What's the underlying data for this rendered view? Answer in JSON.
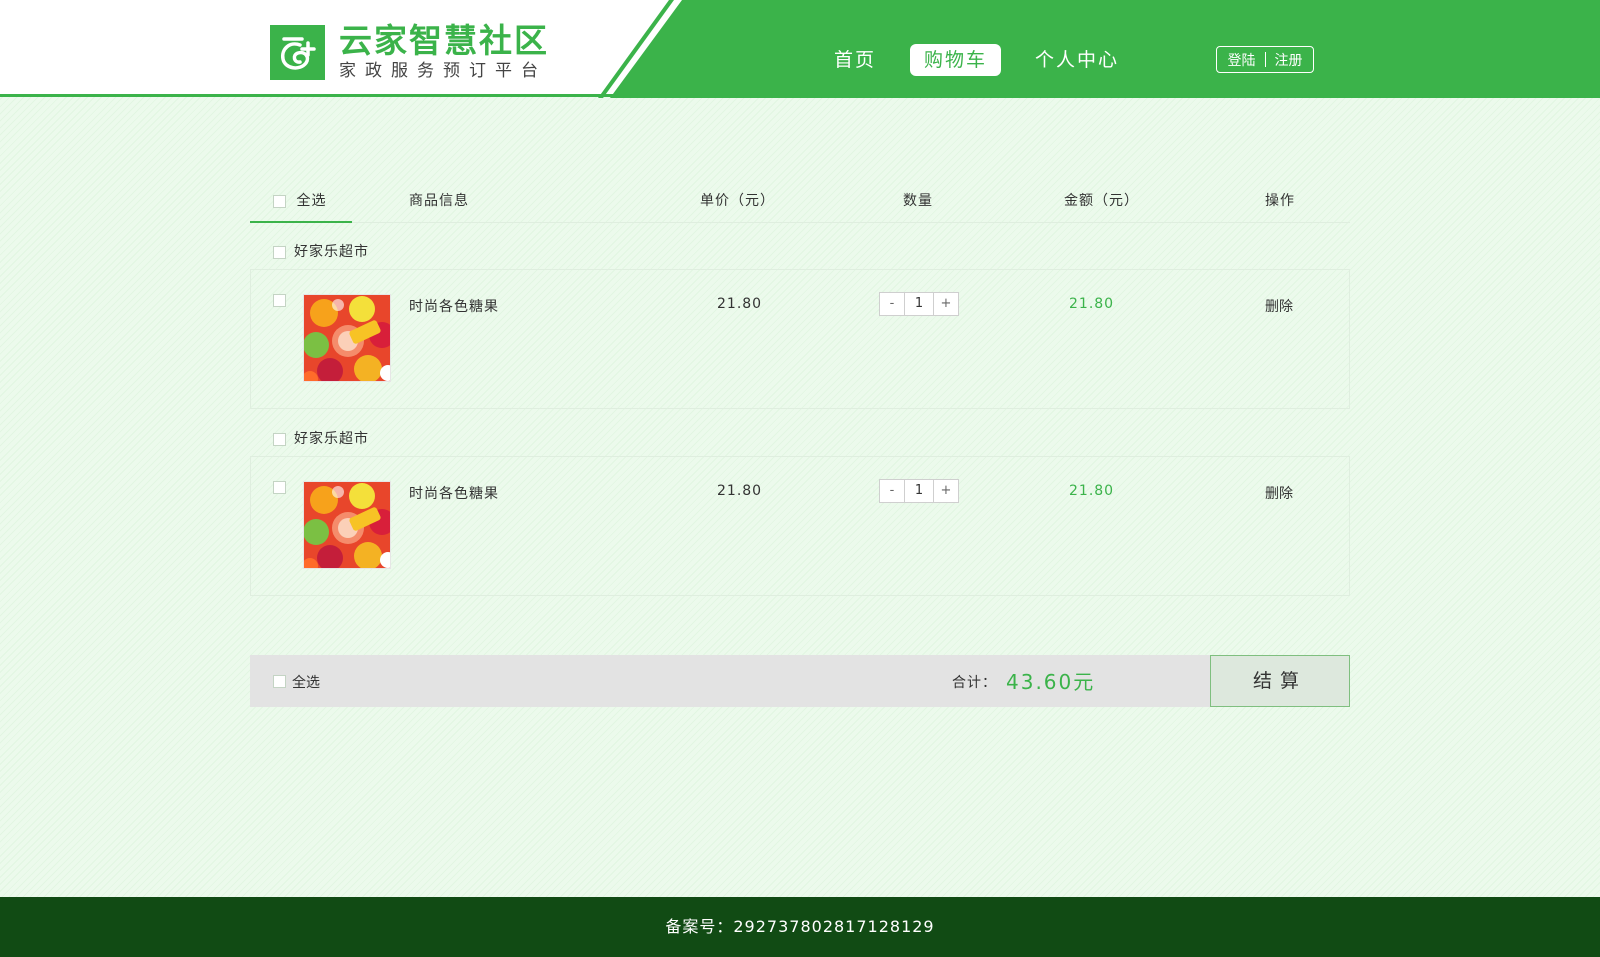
{
  "header": {
    "logo_title": "云家智慧社区",
    "logo_subtitle": "家政服务预订平台",
    "nav": [
      {
        "label": "首页"
      },
      {
        "label": "购物车"
      },
      {
        "label": "个人中心"
      }
    ],
    "login_label": "登陆",
    "register_label": "注册"
  },
  "cart": {
    "columns": {
      "select_all": "全选",
      "product": "商品信息",
      "unit_price": "单价（元）",
      "quantity": "数量",
      "amount": "金额（元）",
      "action": "操作"
    },
    "shops": [
      {
        "name": "好家乐超市",
        "item": {
          "name": "时尚各色糖果",
          "price": "21.80",
          "minus": "-",
          "qty": "1",
          "plus": "+",
          "amount": "21.80",
          "delete": "删除"
        }
      },
      {
        "name": "好家乐超市",
        "item": {
          "name": "时尚各色糖果",
          "price": "21.80",
          "minus": "-",
          "qty": "1",
          "plus": "+",
          "amount": "21.80",
          "delete": "删除"
        }
      }
    ],
    "summary": {
      "select_all": "全选",
      "total_label": "合计：",
      "total_value": "43.60元",
      "checkout": "结算"
    }
  },
  "footer": {
    "icp": "备案号：292737802817128129"
  },
  "colors": {
    "brand_green": "#3bb34a",
    "footer_green": "#114b14"
  },
  "icons": [
    "logo-mark-icon",
    "candy-product-image"
  ]
}
